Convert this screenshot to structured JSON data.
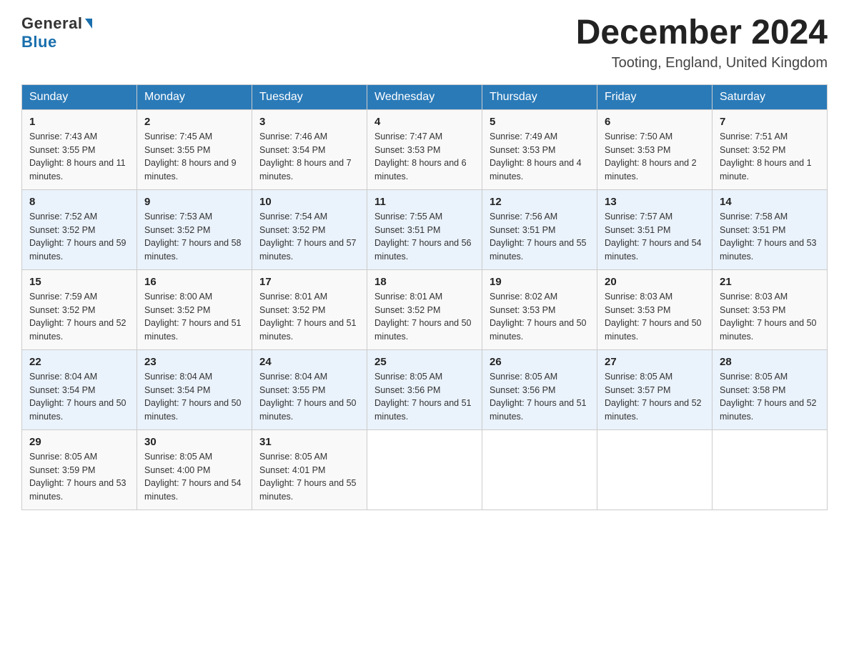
{
  "header": {
    "logo_general": "General",
    "logo_blue": "Blue",
    "month_title": "December 2024",
    "location": "Tooting, England, United Kingdom"
  },
  "weekdays": [
    "Sunday",
    "Monday",
    "Tuesday",
    "Wednesday",
    "Thursday",
    "Friday",
    "Saturday"
  ],
  "weeks": [
    [
      {
        "day": "1",
        "sunrise": "7:43 AM",
        "sunset": "3:55 PM",
        "daylight": "8 hours and 11 minutes."
      },
      {
        "day": "2",
        "sunrise": "7:45 AM",
        "sunset": "3:55 PM",
        "daylight": "8 hours and 9 minutes."
      },
      {
        "day": "3",
        "sunrise": "7:46 AM",
        "sunset": "3:54 PM",
        "daylight": "8 hours and 7 minutes."
      },
      {
        "day": "4",
        "sunrise": "7:47 AM",
        "sunset": "3:53 PM",
        "daylight": "8 hours and 6 minutes."
      },
      {
        "day": "5",
        "sunrise": "7:49 AM",
        "sunset": "3:53 PM",
        "daylight": "8 hours and 4 minutes."
      },
      {
        "day": "6",
        "sunrise": "7:50 AM",
        "sunset": "3:53 PM",
        "daylight": "8 hours and 2 minutes."
      },
      {
        "day": "7",
        "sunrise": "7:51 AM",
        "sunset": "3:52 PM",
        "daylight": "8 hours and 1 minute."
      }
    ],
    [
      {
        "day": "8",
        "sunrise": "7:52 AM",
        "sunset": "3:52 PM",
        "daylight": "7 hours and 59 minutes."
      },
      {
        "day": "9",
        "sunrise": "7:53 AM",
        "sunset": "3:52 PM",
        "daylight": "7 hours and 58 minutes."
      },
      {
        "day": "10",
        "sunrise": "7:54 AM",
        "sunset": "3:52 PM",
        "daylight": "7 hours and 57 minutes."
      },
      {
        "day": "11",
        "sunrise": "7:55 AM",
        "sunset": "3:51 PM",
        "daylight": "7 hours and 56 minutes."
      },
      {
        "day": "12",
        "sunrise": "7:56 AM",
        "sunset": "3:51 PM",
        "daylight": "7 hours and 55 minutes."
      },
      {
        "day": "13",
        "sunrise": "7:57 AM",
        "sunset": "3:51 PM",
        "daylight": "7 hours and 54 minutes."
      },
      {
        "day": "14",
        "sunrise": "7:58 AM",
        "sunset": "3:51 PM",
        "daylight": "7 hours and 53 minutes."
      }
    ],
    [
      {
        "day": "15",
        "sunrise": "7:59 AM",
        "sunset": "3:52 PM",
        "daylight": "7 hours and 52 minutes."
      },
      {
        "day": "16",
        "sunrise": "8:00 AM",
        "sunset": "3:52 PM",
        "daylight": "7 hours and 51 minutes."
      },
      {
        "day": "17",
        "sunrise": "8:01 AM",
        "sunset": "3:52 PM",
        "daylight": "7 hours and 51 minutes."
      },
      {
        "day": "18",
        "sunrise": "8:01 AM",
        "sunset": "3:52 PM",
        "daylight": "7 hours and 50 minutes."
      },
      {
        "day": "19",
        "sunrise": "8:02 AM",
        "sunset": "3:53 PM",
        "daylight": "7 hours and 50 minutes."
      },
      {
        "day": "20",
        "sunrise": "8:03 AM",
        "sunset": "3:53 PM",
        "daylight": "7 hours and 50 minutes."
      },
      {
        "day": "21",
        "sunrise": "8:03 AM",
        "sunset": "3:53 PM",
        "daylight": "7 hours and 50 minutes."
      }
    ],
    [
      {
        "day": "22",
        "sunrise": "8:04 AM",
        "sunset": "3:54 PM",
        "daylight": "7 hours and 50 minutes."
      },
      {
        "day": "23",
        "sunrise": "8:04 AM",
        "sunset": "3:54 PM",
        "daylight": "7 hours and 50 minutes."
      },
      {
        "day": "24",
        "sunrise": "8:04 AM",
        "sunset": "3:55 PM",
        "daylight": "7 hours and 50 minutes."
      },
      {
        "day": "25",
        "sunrise": "8:05 AM",
        "sunset": "3:56 PM",
        "daylight": "7 hours and 51 minutes."
      },
      {
        "day": "26",
        "sunrise": "8:05 AM",
        "sunset": "3:56 PM",
        "daylight": "7 hours and 51 minutes."
      },
      {
        "day": "27",
        "sunrise": "8:05 AM",
        "sunset": "3:57 PM",
        "daylight": "7 hours and 52 minutes."
      },
      {
        "day": "28",
        "sunrise": "8:05 AM",
        "sunset": "3:58 PM",
        "daylight": "7 hours and 52 minutes."
      }
    ],
    [
      {
        "day": "29",
        "sunrise": "8:05 AM",
        "sunset": "3:59 PM",
        "daylight": "7 hours and 53 minutes."
      },
      {
        "day": "30",
        "sunrise": "8:05 AM",
        "sunset": "4:00 PM",
        "daylight": "7 hours and 54 minutes."
      },
      {
        "day": "31",
        "sunrise": "8:05 AM",
        "sunset": "4:01 PM",
        "daylight": "7 hours and 55 minutes."
      },
      null,
      null,
      null,
      null
    ]
  ]
}
